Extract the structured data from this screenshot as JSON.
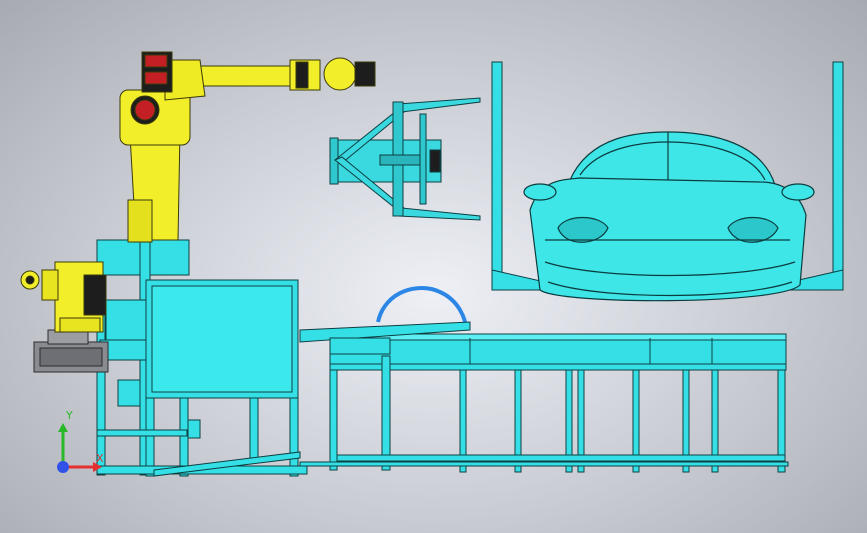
{
  "colors": {
    "frame": "#34e0e6",
    "frame_edge": "#0d3f42",
    "robot": "#f2ee2a",
    "robot_edge": "#3b3a08",
    "motor": "#c41f24",
    "motor_dark": "#1d1d1d",
    "car": "#3fe6e8",
    "car_edge": "#0b3c3e",
    "pipe": "#2c86e6",
    "gripper_plate": "#3ad9df",
    "base_gray": "#8a8b90",
    "axis_x": "#e53030",
    "axis_y": "#28b828",
    "axis_z": "#3052e8"
  },
  "icons": {
    "coordinate_triad": "xyz-axis-triad-icon"
  },
  "triad": {
    "y_label": "Y",
    "x_label": "X"
  }
}
